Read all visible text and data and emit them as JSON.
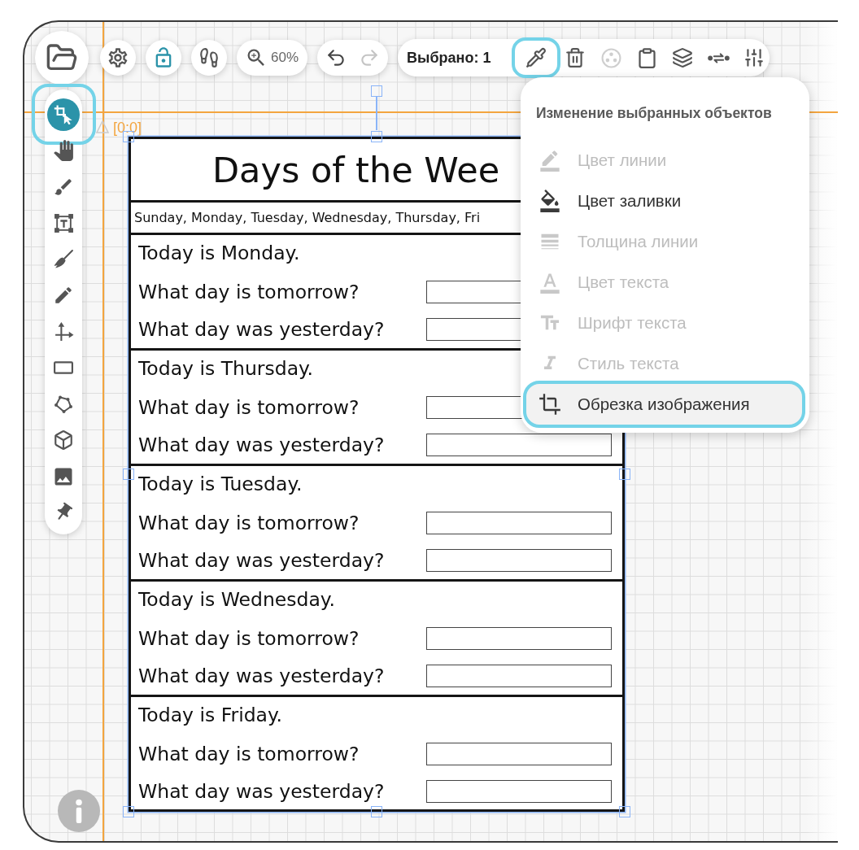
{
  "main_toolbar": [
    {
      "kind": "folder"
    },
    {
      "kind": "settings"
    },
    {
      "kind": "lock"
    },
    {
      "kind": "footprints"
    }
  ],
  "zoom": {
    "label": "60%"
  },
  "history": [
    {
      "kind": "undo",
      "disabled": false
    },
    {
      "kind": "redo",
      "disabled": true
    }
  ],
  "selection_bar": {
    "label": "Выбрано: 1",
    "actions": [
      {
        "kind": "eyedropper",
        "disabled": false,
        "highlighted": true
      },
      {
        "kind": "delete",
        "disabled": false,
        "highlighted": false
      },
      {
        "kind": "palette",
        "disabled": true,
        "highlighted": false
      },
      {
        "kind": "paste",
        "disabled": false,
        "highlighted": false
      },
      {
        "kind": "layers",
        "disabled": false,
        "highlighted": false
      },
      {
        "kind": "connect",
        "disabled": false,
        "highlighted": false
      },
      {
        "kind": "adjust",
        "disabled": false,
        "highlighted": false
      }
    ]
  },
  "tools": [
    {
      "kind": "crop-select",
      "selected": true,
      "highlighted": true
    },
    {
      "kind": "hand",
      "selected": false,
      "highlighted": false
    },
    {
      "kind": "brush",
      "selected": false,
      "highlighted": false
    },
    {
      "kind": "text-box",
      "selected": false,
      "highlighted": false
    },
    {
      "kind": "broom",
      "selected": false,
      "highlighted": false
    },
    {
      "kind": "pencil",
      "selected": false,
      "highlighted": false
    },
    {
      "kind": "axes",
      "selected": false,
      "highlighted": false
    },
    {
      "kind": "rectangle",
      "selected": false,
      "highlighted": false
    },
    {
      "kind": "polygon",
      "selected": false,
      "highlighted": false
    },
    {
      "kind": "cube",
      "selected": false,
      "highlighted": false
    },
    {
      "kind": "image",
      "selected": false,
      "highlighted": false
    },
    {
      "kind": "pin",
      "selected": false,
      "highlighted": false
    }
  ],
  "canvas": {
    "origin_label": "[0:0]",
    "worksheet": {
      "title": "Days of the Wee",
      "days_line": "Sunday, Monday, Tuesday, Wednesday, Thursday, Fri",
      "sections": [
        {
          "today": "Today is Monday.",
          "questions": [
            "What day is tomorrow?",
            "What day was yesterday?"
          ]
        },
        {
          "today": "Today is Thursday.",
          "questions": [
            "What day is tomorrow?",
            "What day was yesterday?"
          ]
        },
        {
          "today": "Today is Tuesday.",
          "questions": [
            "What day is tomorrow?",
            "What day was yesterday?"
          ]
        },
        {
          "today": "Today is Wednesday.",
          "questions": [
            "What day is tomorrow?",
            "What day was yesterday?"
          ]
        },
        {
          "today": "Today is Friday.",
          "questions": [
            "What day is tomorrow?",
            "What day was yesterday?"
          ]
        }
      ]
    }
  },
  "menu": {
    "title": "Изменение выбранных объектов",
    "items": [
      {
        "kind": "line-color",
        "label": "Цвет линии",
        "disabled": true,
        "highlighted": false
      },
      {
        "kind": "fill-color",
        "label": "Цвет заливки",
        "disabled": false,
        "highlighted": false
      },
      {
        "kind": "line-width",
        "label": "Толщина линии",
        "disabled": true,
        "highlighted": false
      },
      {
        "kind": "text-color",
        "label": "Цвет текста",
        "disabled": true,
        "highlighted": false
      },
      {
        "kind": "font",
        "label": "Шрифт текста",
        "disabled": true,
        "highlighted": false
      },
      {
        "kind": "text-style",
        "label": "Стиль текста",
        "disabled": true,
        "highlighted": false
      },
      {
        "kind": "crop",
        "label": "Обрезка изображения",
        "disabled": false,
        "highlighted": true
      }
    ]
  }
}
